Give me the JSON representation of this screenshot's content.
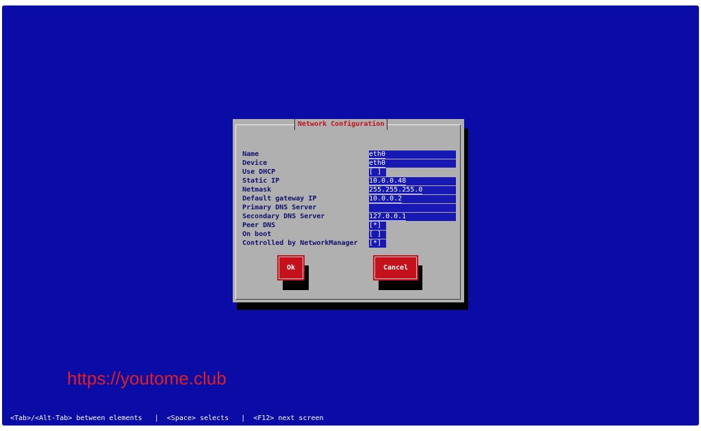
{
  "dialog": {
    "title": "Network Configuration",
    "fields": [
      {
        "label": "Name",
        "value": "eth0",
        "kind": "text"
      },
      {
        "label": "Device",
        "value": "eth0",
        "kind": "text"
      },
      {
        "label": "Use DHCP",
        "value": "[ ]",
        "kind": "checkbox"
      },
      {
        "label": "Static IP",
        "value": "10.0.0.48",
        "kind": "text"
      },
      {
        "label": "Netmask",
        "value": "255.255.255.0",
        "kind": "text"
      },
      {
        "label": "Default gateway IP",
        "value": "10.0.0.2",
        "kind": "text"
      },
      {
        "label": "Primary DNS Server",
        "value": "",
        "kind": "text"
      },
      {
        "label": "Secondary DNS Server",
        "value": "127.0.0.1",
        "kind": "text"
      },
      {
        "label": "Peer DNS",
        "value": "[*]",
        "kind": "checkbox"
      },
      {
        "label": "On boot",
        "value": "[ ]",
        "kind": "checkbox"
      },
      {
        "label": "Controlled by NetworkManager",
        "value": "[*]",
        "kind": "checkbox"
      }
    ],
    "ok_label": "Ok",
    "cancel_label": "Cancel"
  },
  "watermark": "https://youtome.club",
  "status_bar": "<Tab>/<Alt-Tab> between elements   |  <Space> selects   |  <F12> next screen",
  "colors": {
    "background": "#0b0ba6",
    "dialog": "#b0b0b0",
    "title": "#c4111b",
    "button": "#c4111b",
    "field": "#1818b4"
  }
}
